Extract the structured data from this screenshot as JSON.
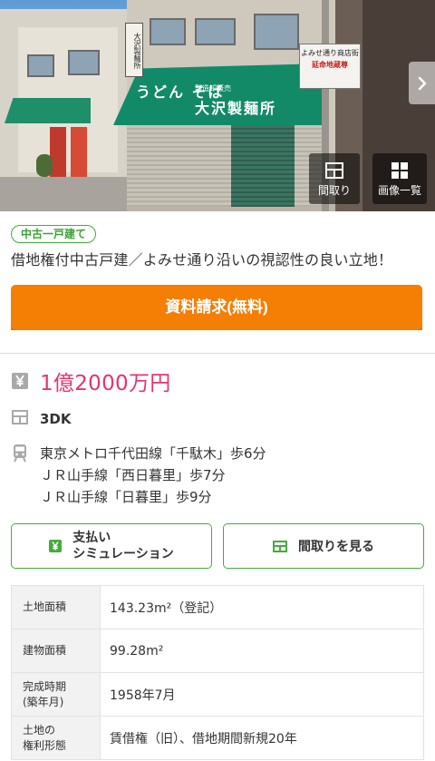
{
  "gallery": {
    "awning_line1": "うどん そば",
    "awning_small": "製造卸販売",
    "awning_line2": "大沢製麺所",
    "vertical_sign": "大沢製麺所",
    "shop_sign_title": "よみせ通り商店街",
    "shop_sign_red": "延命地蔵尊",
    "buttons": {
      "floor_plan": "間取り",
      "image_list": "画像一覧"
    },
    "next_icon": "chevron-right-icon"
  },
  "property": {
    "type_tag": "中古一戸建て",
    "headline": "借地権付中古戸建／よみせ通り沿いの視認性の良い立地！",
    "cta_label": "資料請求(無料)",
    "price": "1億2000万円",
    "layout": "3DK",
    "access": [
      "東京メトロ千代田線「千駄木」歩6分",
      "ＪＲ山手線「西日暮里」歩7分",
      "ＪＲ山手線「日暮里」歩9分"
    ]
  },
  "actions": {
    "payment_sim_line1": "支払い",
    "payment_sim_line2": "シミュレーション",
    "view_floor_plan": "間取りを見る"
  },
  "spec": [
    {
      "label": "土地面積",
      "value": "143.23m²（登記）"
    },
    {
      "label": "建物面積",
      "value": "99.28m²"
    },
    {
      "label_line1": "完成時期",
      "label_line2": "(築年月)",
      "value": "1958年7月"
    },
    {
      "label_line1": "土地の",
      "label_line2": "権利形態",
      "value": "賃借権（旧）、借地期間新規20年"
    }
  ],
  "colors": {
    "accent_orange": "#f57e05",
    "accent_green": "#42ad3a",
    "price_pink": "#e8336c"
  }
}
